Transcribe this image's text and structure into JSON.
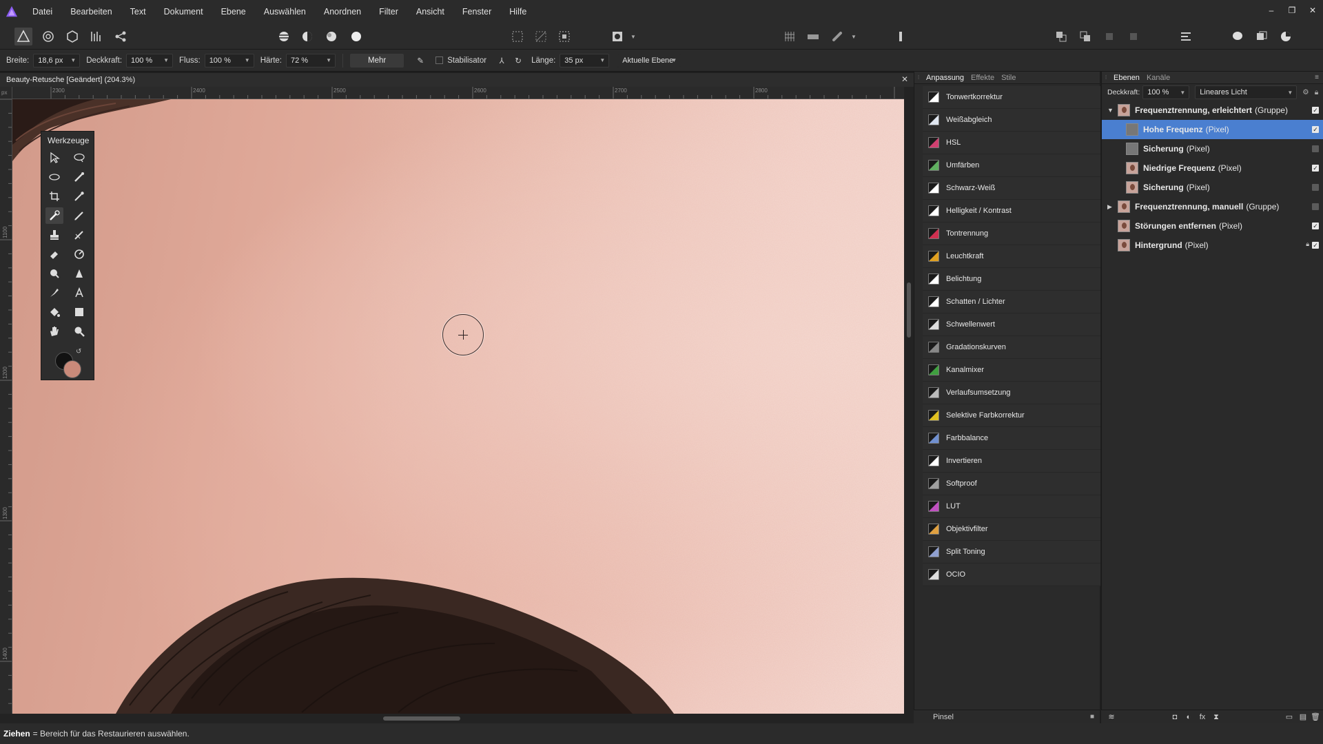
{
  "menubar": {
    "items": [
      "Datei",
      "Bearbeiten",
      "Text",
      "Dokument",
      "Ebene",
      "Auswählen",
      "Anordnen",
      "Filter",
      "Ansicht",
      "Fenster",
      "Hilfe"
    ]
  },
  "window_controls": {
    "minimize": "–",
    "restore": "❐",
    "close": "✕"
  },
  "context_bar": {
    "width_label": "Breite:",
    "width_value": "18,6 px",
    "opacity_label": "Deckkraft:",
    "opacity_value": "100 %",
    "flow_label": "Fluss:",
    "flow_value": "100 %",
    "hardness_label": "Härte:",
    "hardness_value": "72 %",
    "more_label": "Mehr",
    "stabilizer_label": "Stabilisator",
    "length_label": "Länge:",
    "length_value": "35 px",
    "layer_scope": "Aktuelle Ebene"
  },
  "document": {
    "title": "Beauty-Retusche [Geändert] (204.3%)",
    "ruler_top": [
      "2300",
      "2400",
      "2500",
      "2600",
      "2700",
      "2800"
    ],
    "ruler_left": [
      "1100",
      "1200",
      "1300",
      "1400"
    ],
    "ruler_unit": "px"
  },
  "tools_panel": {
    "title": "Werkzeuge"
  },
  "adjustment_panel": {
    "tabs": [
      "Anpassung",
      "Effekte",
      "Stile"
    ],
    "items": [
      {
        "label": "Tonwertkorrektur",
        "icon": "levels-icon",
        "color": "#ffffff"
      },
      {
        "label": "Weißabgleich",
        "icon": "white-balance-icon",
        "color": "#e0e6f0"
      },
      {
        "label": "HSL",
        "icon": "hsl-icon",
        "color": "#d04070"
      },
      {
        "label": "Umfärben",
        "icon": "recolor-icon",
        "color": "#60b060"
      },
      {
        "label": "Schwarz-Weiß",
        "icon": "black-white-icon",
        "color": "#ffffff"
      },
      {
        "label": "Helligkeit / Kontrast",
        "icon": "brightness-contrast-icon",
        "color": "#ffffff"
      },
      {
        "label": "Tontrennung",
        "icon": "posterize-icon",
        "color": "#d03050"
      },
      {
        "label": "Leuchtkraft",
        "icon": "vibrance-icon",
        "color": "#e0a020"
      },
      {
        "label": "Belichtung",
        "icon": "exposure-icon",
        "color": "#ffffff"
      },
      {
        "label": "Schatten / Lichter",
        "icon": "shadows-highlights-icon",
        "color": "#ffffff"
      },
      {
        "label": "Schwellenwert",
        "icon": "threshold-icon",
        "color": "#dddddd"
      },
      {
        "label": "Gradationskurven",
        "icon": "curves-icon",
        "color": "#888888"
      },
      {
        "label": "Kanalmixer",
        "icon": "channel-mixer-icon",
        "color": "#40a040"
      },
      {
        "label": "Verlaufsumsetzung",
        "icon": "gradient-map-icon",
        "color": "#bbbbbb"
      },
      {
        "label": "Selektive Farbkorrektur",
        "icon": "selective-color-icon",
        "color": "#e0c020"
      },
      {
        "label": "Farbbalance",
        "icon": "color-balance-icon",
        "color": "#7090d0"
      },
      {
        "label": "Invertieren",
        "icon": "invert-icon",
        "color": "#ffffff"
      },
      {
        "label": "Softproof",
        "icon": "soft-proof-icon",
        "color": "#a0a0a0"
      },
      {
        "label": "LUT",
        "icon": "lut-icon",
        "color": "#c050c0"
      },
      {
        "label": "Objektivfilter",
        "icon": "lens-filter-icon",
        "color": "#e0a040"
      },
      {
        "label": "Split Toning",
        "icon": "split-toning-icon",
        "color": "#90a0d0"
      },
      {
        "label": "OCIO",
        "icon": "ocio-icon",
        "color": "#dddddd"
      }
    ],
    "footer_label": "Pinsel"
  },
  "layers_panel": {
    "tabs": [
      "Ebenen",
      "Kanäle"
    ],
    "opacity_label": "Deckkraft:",
    "opacity_value": "100 %",
    "blend_mode": "Lineares Licht",
    "layers": [
      {
        "name": "Frequenztrennung, erleichtert",
        "type": "(Gruppe)",
        "level": 0,
        "disclosure": "open",
        "visible": true,
        "selected": false,
        "thumb": "face"
      },
      {
        "name": "Hohe Frequenz",
        "type": "(Pixel)",
        "level": 1,
        "visible": true,
        "selected": true,
        "thumb": "grey"
      },
      {
        "name": "Sicherung",
        "type": "(Pixel)",
        "level": 1,
        "visible": false,
        "selected": false,
        "thumb": "grey"
      },
      {
        "name": "Niedrige Frequenz",
        "type": "(Pixel)",
        "level": 1,
        "visible": true,
        "selected": false,
        "thumb": "face"
      },
      {
        "name": "Sicherung",
        "type": "(Pixel)",
        "level": 1,
        "visible": false,
        "selected": false,
        "thumb": "face"
      },
      {
        "name": "Frequenztrennung, manuell",
        "type": "(Gruppe)",
        "level": 0,
        "disclosure": "closed",
        "visible": false,
        "selected": false,
        "thumb": "face"
      },
      {
        "name": "Störungen entfernen",
        "type": "(Pixel)",
        "level": 0,
        "visible": true,
        "selected": false,
        "thumb": "face"
      },
      {
        "name": "Hintergrund",
        "type": "(Pixel)",
        "level": 0,
        "visible": true,
        "selected": false,
        "thumb": "face",
        "locked": true
      }
    ]
  },
  "statusbar": {
    "action": "Ziehen",
    "hint": "= Bereich für das Restaurieren auswählen."
  },
  "colors": {
    "primary": "#121212",
    "secondary": "#c98a7a",
    "selection": "#4a7fd0",
    "brand": "#8a5cf0"
  }
}
